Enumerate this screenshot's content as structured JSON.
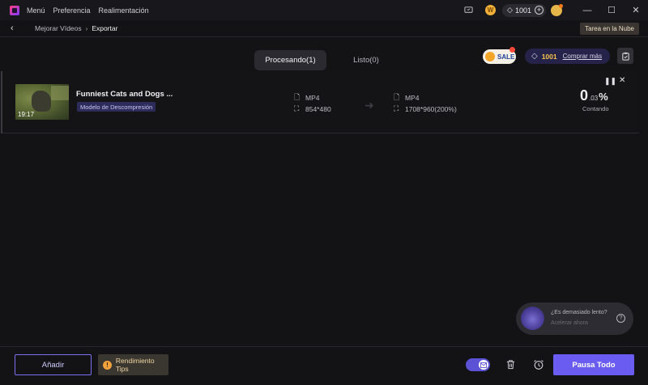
{
  "titlebar": {
    "menu": [
      "Menú",
      "Preferencia",
      "Realimentación"
    ],
    "credits": "1001",
    "coin_label": "W"
  },
  "breadcrumb": {
    "items": [
      "Mejorar Vídeos",
      "Exportar"
    ],
    "cloud_task": "Tarea en la Nube"
  },
  "tabs": {
    "processing": "Procesando(1)",
    "done": "Listo(0)"
  },
  "promo": {
    "sale": "SALE",
    "credits": "1001",
    "buy_more": "Comprar más"
  },
  "task": {
    "thumb_time": "19:17",
    "title": "Funniest Cats and Dogs ...",
    "model": "Modelo de Descompresión",
    "source": {
      "format": "MP4",
      "resolution": "854*480"
    },
    "target": {
      "format": "MP4",
      "resolution": "1708*960(200%)"
    },
    "progress_int": "0",
    "progress_dec": ".03",
    "progress_sign": "%",
    "status": "Contando"
  },
  "toast": {
    "question": "¿Es demasiado lento?",
    "action": "Acelerar ahora",
    "help": "?"
  },
  "bottom": {
    "add": "Añadir",
    "tips": "Rendimiento Tips",
    "pause_all": "Pausa Todo"
  },
  "colors": {
    "accent": "#6a5cf0",
    "background": "#131316"
  }
}
